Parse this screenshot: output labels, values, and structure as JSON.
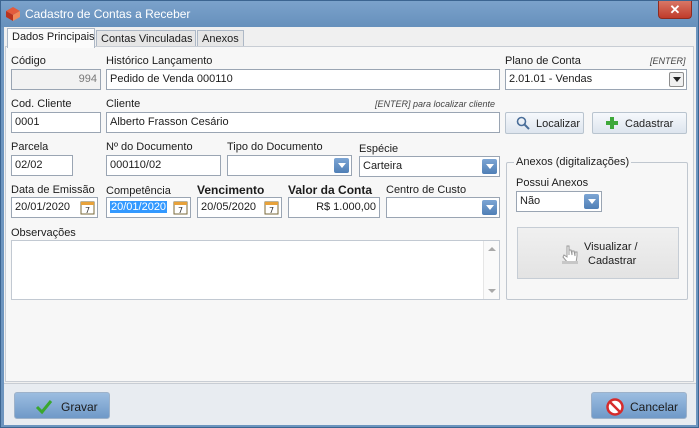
{
  "window": {
    "title": "Cadastro de Contas a Receber",
    "close_label": "✕"
  },
  "tabs": [
    {
      "label": "Dados Principais",
      "active": true
    },
    {
      "label": "Contas Vinculadas",
      "active": false
    },
    {
      "label": "Anexos",
      "active": false
    }
  ],
  "form": {
    "codigo": {
      "label": "Código",
      "value": "994"
    },
    "historico": {
      "label": "Histórico Lançamento",
      "value": "Pedido de Venda 000110"
    },
    "plano": {
      "label": "Plano de Conta",
      "hint": "[ENTER]",
      "value": "2.01.01 - Vendas"
    },
    "cod_cliente": {
      "label": "Cod. Cliente",
      "value": "0001"
    },
    "cliente": {
      "label": "Cliente",
      "hint": "[ENTER] para localizar cliente",
      "value": "Alberto Frasson Cesário"
    },
    "localizar_label": "Localizar",
    "cadastrar_label": "Cadastrar",
    "parcela": {
      "label": "Parcela",
      "value": "02/02"
    },
    "num_documento": {
      "label": "Nº do Documento",
      "value": "000110/02"
    },
    "tipo_documento": {
      "label": "Tipo do Documento",
      "value": ""
    },
    "especie": {
      "label": "Espécie",
      "value": "Carteira"
    },
    "data_emissao": {
      "label": "Data de Emissão",
      "value": "20/01/2020"
    },
    "competencia": {
      "label": "Competência",
      "value": "20/01/2020"
    },
    "vencimento": {
      "label": "Vencimento",
      "value": "20/05/2020"
    },
    "valor": {
      "label": "Valor da Conta",
      "value": "R$ 1.000,00"
    },
    "centro_custo": {
      "label": "Centro de Custo",
      "value": ""
    },
    "observacoes": {
      "label": "Observações",
      "value": ""
    }
  },
  "anexos_group": {
    "title": "Anexos (digitalizações)",
    "possui_label": "Possui Anexos",
    "possui_value": "Não",
    "visualizar_label_1": "Visualizar /",
    "visualizar_label_2": "Cadastrar"
  },
  "footer": {
    "gravar_label": "Gravar",
    "cancelar_label": "Cancelar"
  },
  "colors": {
    "titlebar": "#6d95bf",
    "accent": "#3399ff",
    "dropdown": "#5b8cc4",
    "close": "#c44a3a"
  }
}
